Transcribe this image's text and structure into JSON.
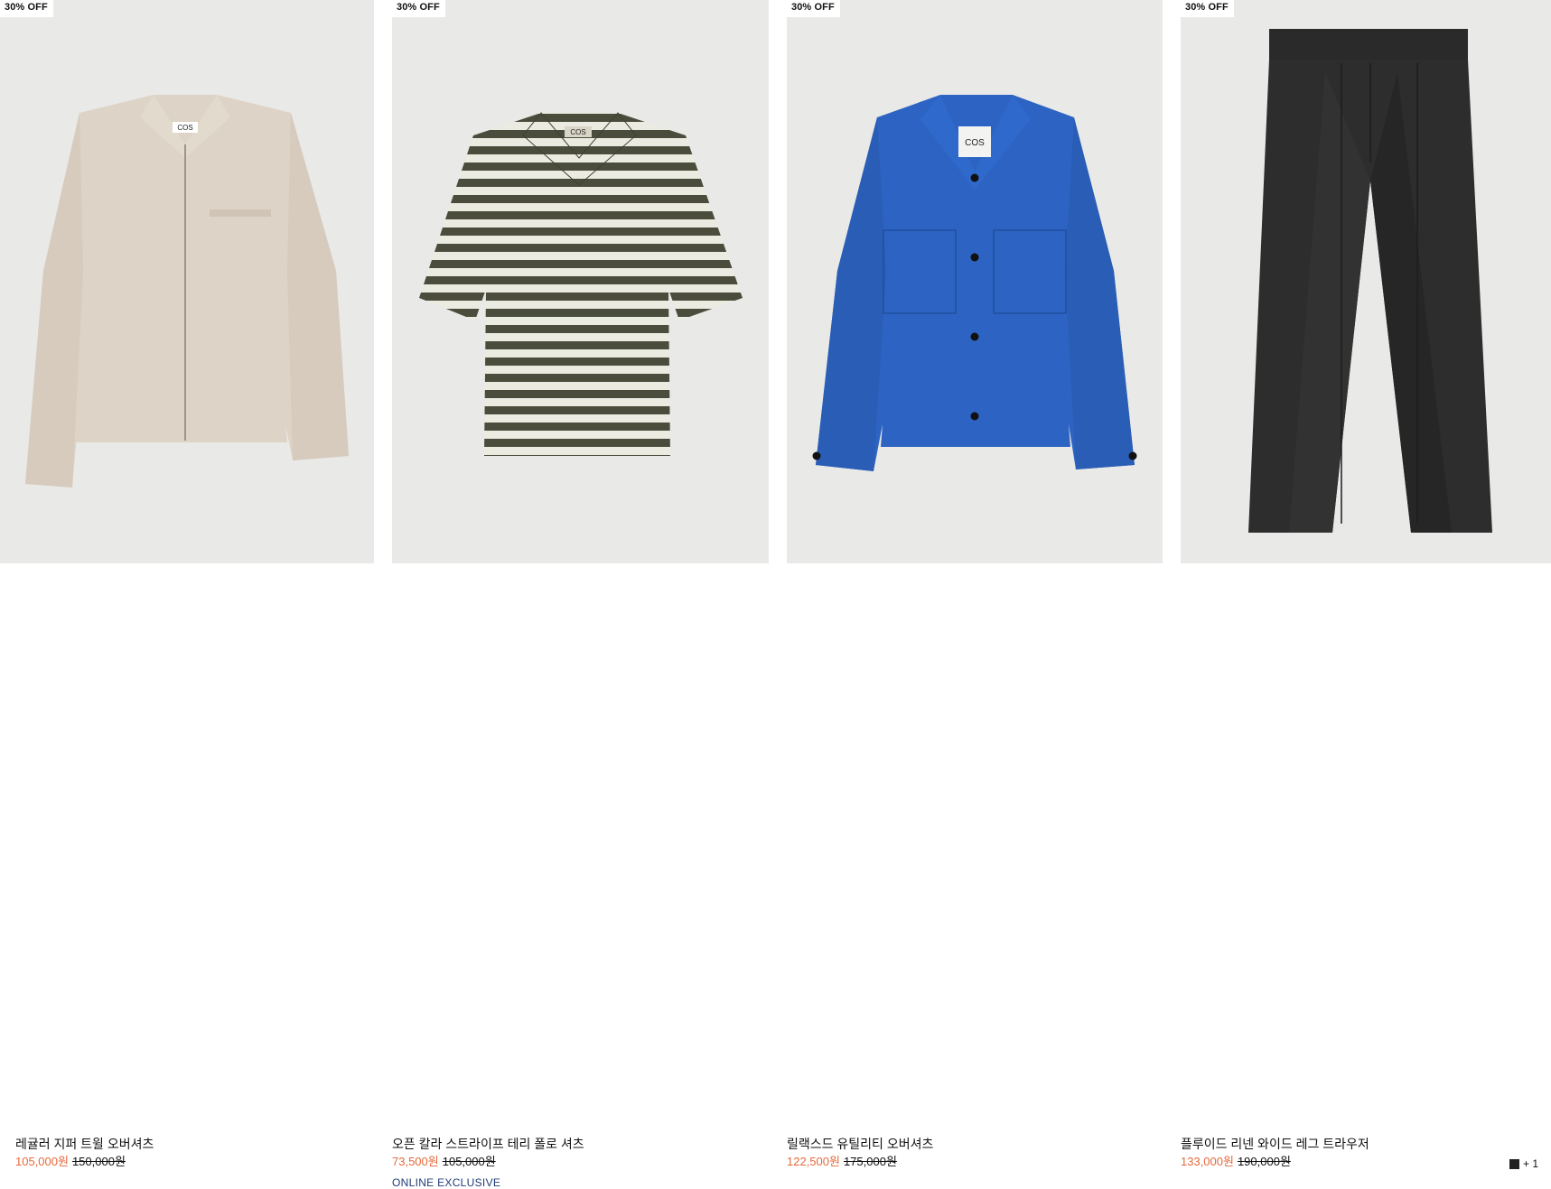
{
  "products": [
    {
      "badge": "30% OFF",
      "title": "레귤러 지퍼 트윌 오버셔츠",
      "price_sale": "105,000원",
      "price_orig": "150,000원",
      "image_icon": "zip-overshirt-beige-image",
      "bg_color": "#e9e9e7",
      "garment_color": "#ddd3c6"
    },
    {
      "badge": "30% OFF",
      "title": "오픈 칼라 스트라이프 테리 폴로 셔츠",
      "price_sale": "73,500원",
      "price_orig": "105,000원",
      "tag": "ONLINE EXCLUSIVE",
      "image_icon": "striped-polo-shirt-image",
      "bg_color": "#e9e9e7",
      "stripe_dark": "#4a4d3b",
      "stripe_light": "#ecebe2"
    },
    {
      "badge": "30% OFF",
      "title": "릴랙스드 유틸리티 오버셔츠",
      "price_sale": "122,500원",
      "price_orig": "175,000원",
      "image_icon": "utility-overshirt-blue-image",
      "bg_color": "#e9e9e7",
      "garment_color": "#2d64c3"
    },
    {
      "badge": "30% OFF",
      "title": "플루이드 리넨 와이드 레그 트라우저",
      "price_sale": "133,000원",
      "price_orig": "190,000원",
      "swatch_extra": "+ 1",
      "image_icon": "linen-trousers-black-image",
      "bg_color": "#e9e9e7",
      "garment_color": "#2a2a2a"
    }
  ],
  "label_text": "COS",
  "colors": {
    "sale": "#e66a3c",
    "exclusive": "#1f3c78"
  }
}
